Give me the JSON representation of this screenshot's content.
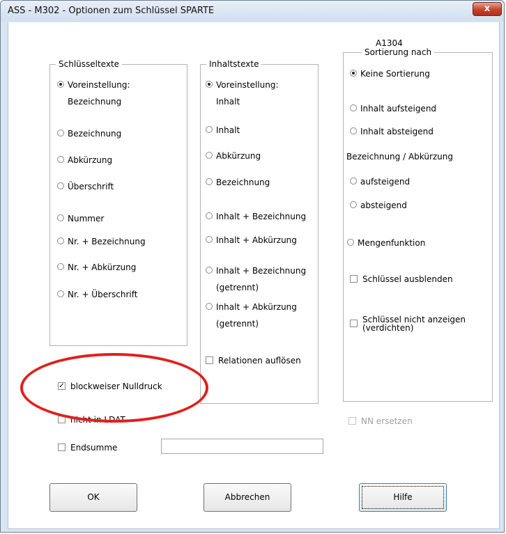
{
  "window": {
    "title": "ASS - M302 - Optionen zum Schlüssel SPARTE",
    "close_glyph": "x"
  },
  "schluesseltexte": {
    "legend": "Schlüsseltexte",
    "selected_index": 0,
    "options": [
      {
        "line1": "Voreinstellung:",
        "line2": "Bezeichnung"
      },
      {
        "line1": "Bezeichnung"
      },
      {
        "line1": "Abkürzung"
      },
      {
        "line1": "Überschrift"
      },
      {
        "line1": "Nummer"
      },
      {
        "line1": "Nr. + Bezeichnung"
      },
      {
        "line1": "Nr. + Abkürzung"
      },
      {
        "line1": "Nr. + Überschrift"
      }
    ]
  },
  "inhaltstexte": {
    "legend": "Inhaltstexte",
    "selected_index": 0,
    "options": [
      {
        "line1": "Voreinstellung:",
        "line2": "Inhalt"
      },
      {
        "line1": "Inhalt"
      },
      {
        "line1": "Abkürzung"
      },
      {
        "line1": "Bezeichnung"
      },
      {
        "line1": "Inhalt + Bezeichnung"
      },
      {
        "line1": "Inhalt + Abkürzung"
      },
      {
        "line1": "Inhalt + Bezeichnung",
        "line2": "(getrennt)"
      },
      {
        "line1": "Inhalt + Abkürzung",
        "line2": "(getrennt)"
      }
    ],
    "relationen_label": "Relationen auflösen"
  },
  "sortierung": {
    "code": "A1304",
    "legend": "Sortierung nach",
    "keine_label": "Keine Sortierung",
    "inhalt_auf_label": "Inhalt aufsteigend",
    "inhalt_ab_label": "Inhalt absteigend",
    "subheading": "Bezeichnung / Abkürzung",
    "aufsteigend_label": "aufsteigend",
    "absteigend_label": "absteigend",
    "mengen_label": "Mengenfunktion",
    "ausblenden_label": "Schlüssel ausblenden",
    "nicht_anzeigen_line1": "Schlüssel nicht anzeigen",
    "nicht_anzeigen_line2": "(verdichten)"
  },
  "bottom": {
    "blockweiser_label": "blockweiser Nulldruck",
    "blockweiser_check": "✓",
    "ldat_label": "nicht in LDAT",
    "nn_label": "NN ersetzen",
    "endsumme_label": "Endsumme",
    "endsumme_value": ""
  },
  "buttons": {
    "ok": "OK",
    "abbrechen": "Abbrechen",
    "hilfe": "Hilfe"
  },
  "annotation": {
    "highlight_color": "#e0201b"
  }
}
